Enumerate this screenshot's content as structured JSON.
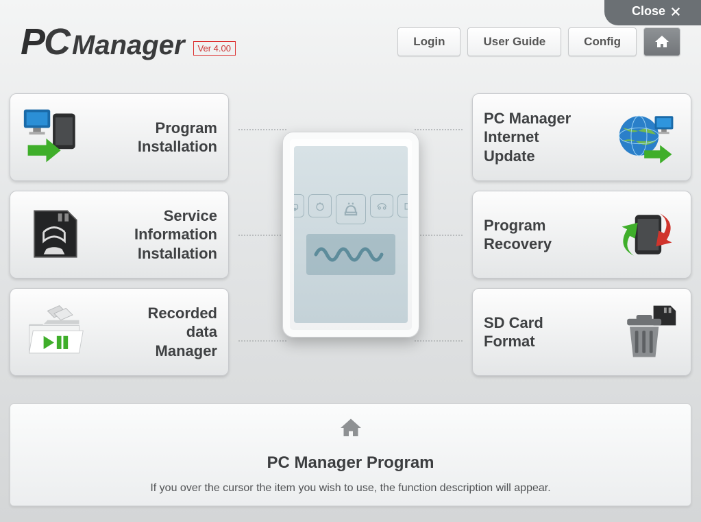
{
  "close_label": "Close",
  "brand": {
    "pc": "PC",
    "manager": "Manager"
  },
  "version": "Ver 4.00",
  "header_buttons": {
    "login": "Login",
    "user_guide": "User Guide",
    "config": "Config"
  },
  "cards": {
    "left": [
      {
        "label": "Program\nInstallation"
      },
      {
        "label": "Service\nInformation\nInstallation"
      },
      {
        "label": "Recorded\ndata\nManager"
      }
    ],
    "right": [
      {
        "label": "PC Manager\nInternet\nUpdate"
      },
      {
        "label": "Program\nRecovery"
      },
      {
        "label": "SD Card\nFormat"
      }
    ]
  },
  "footer": {
    "title": "PC Manager Program",
    "desc": "If you over the cursor the item you wish to use, the function description will appear."
  }
}
